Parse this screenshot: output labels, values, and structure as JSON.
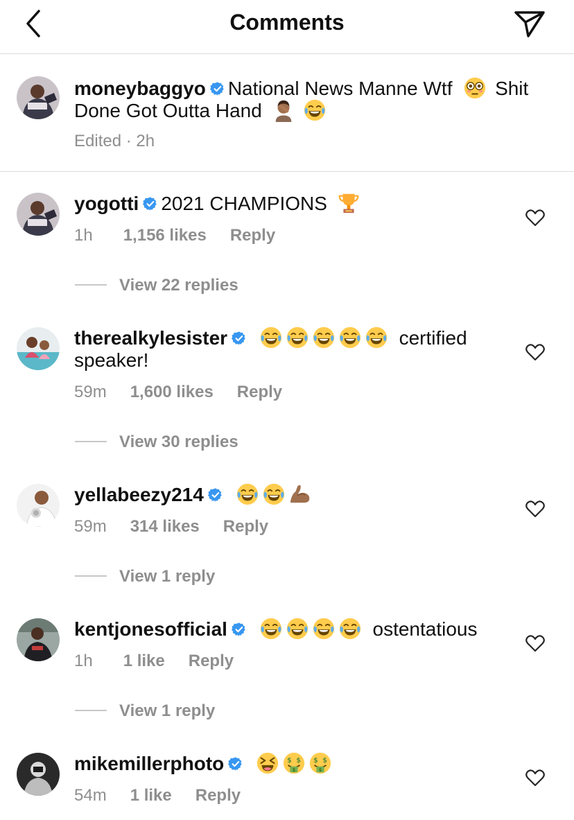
{
  "header": {
    "title": "Comments"
  },
  "caption": {
    "username": "moneybaggyo",
    "text_line1": "National News Manne Wtf",
    "text_line1_after": "Shit",
    "text_line2": "Done Got Outta Hand",
    "meta": "Edited · 2h"
  },
  "comments": [
    {
      "username": "yogotti",
      "text": "2021 CHAMPIONS",
      "time": "1h",
      "likes": "1,156 likes",
      "reply": "Reply",
      "view_replies": "View 22 replies"
    },
    {
      "username": "therealkylesister",
      "text": "certified",
      "text_line2": "speaker!",
      "time": "59m",
      "likes": "1,600 likes",
      "reply": "Reply",
      "view_replies": "View 30 replies"
    },
    {
      "username": "yellabeezy214",
      "text": "",
      "time": "59m",
      "likes": "314 likes",
      "reply": "Reply",
      "view_replies": "View 1 reply"
    },
    {
      "username": "kentjonesofficial",
      "text": "ostentatious",
      "time": "1h",
      "likes": "1 like",
      "reply": "Reply",
      "view_replies": "View 1 reply"
    },
    {
      "username": "mikemillerphoto",
      "text": "",
      "time": "54m",
      "likes": "1 like",
      "reply": "Reply"
    }
  ],
  "colors": {
    "verified": "#3897f0",
    "secondary_text": "#8e8e8e",
    "divider": "#dbdbdb",
    "emoji_yellow": "#ffcc4d"
  }
}
